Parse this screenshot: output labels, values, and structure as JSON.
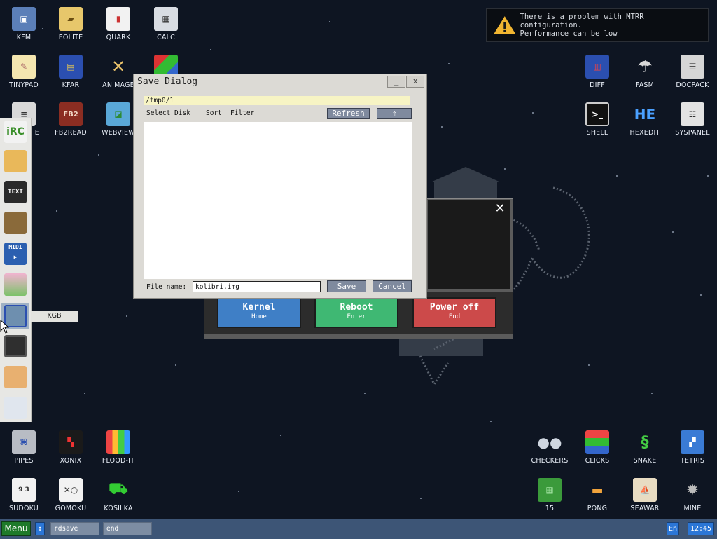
{
  "desktop": {
    "icons_top_left": [
      {
        "label": "KFM",
        "icon": "floppy-icon"
      },
      {
        "label": "EOLITE",
        "icon": "folder-icon"
      },
      {
        "label": "QUARK",
        "icon": "notebook-icon"
      },
      {
        "label": "CALC",
        "icon": "calculator-icon"
      },
      {
        "label": "TINYPAD",
        "icon": "notepad-icon"
      },
      {
        "label": "KFAR",
        "icon": "kfar-icon"
      },
      {
        "label": "ANIMAGE",
        "icon": "paint-tools-icon"
      },
      {
        "label": "E",
        "icon": "text-editor-icon"
      },
      {
        "label": "FB2READ",
        "icon": "book-icon"
      },
      {
        "label": "WEBVIEW",
        "icon": "globe-icon"
      }
    ],
    "icons_top_right": [
      {
        "label": "DIFF",
        "icon": "diff-icon"
      },
      {
        "label": "FASM",
        "icon": "fasm-icon"
      },
      {
        "label": "DOCPACK",
        "icon": "cabinet-icon"
      },
      {
        "label": "SHELL",
        "icon": "terminal-icon"
      },
      {
        "label": "HEXEDIT",
        "icon": "hex-icon"
      },
      {
        "label": "SYSPANEL",
        "icon": "sliders-icon"
      }
    ],
    "icons_bottom_left": [
      {
        "label": "PIPES",
        "icon": "pipes-icon"
      },
      {
        "label": "XONIX",
        "icon": "xonix-icon"
      },
      {
        "label": "FLOOD-IT",
        "icon": "flood-icon"
      },
      {
        "label": "SUDOKU",
        "icon": "sudoku-icon"
      },
      {
        "label": "GOMOKU",
        "icon": "gomoku-icon"
      },
      {
        "label": "KOSILKA",
        "icon": "mower-icon"
      }
    ],
    "icons_bottom_right": [
      {
        "label": "CHECKERS",
        "icon": "checkers-icon"
      },
      {
        "label": "CLICKS",
        "icon": "clicks-icon"
      },
      {
        "label": "SNAKE",
        "icon": "snake-icon"
      },
      {
        "label": "TETRIS",
        "icon": "tetris-icon"
      },
      {
        "label": "15",
        "icon": "fifteen-icon"
      },
      {
        "label": "PONG",
        "icon": "pong-icon"
      },
      {
        "label": "SEAWAR",
        "icon": "seawar-icon"
      },
      {
        "label": "MINE",
        "icon": "mine-icon"
      }
    ]
  },
  "notification": {
    "line1": "There is a problem with MTRR configuration.",
    "line2": "Performance can be low"
  },
  "dock": {
    "tooltip": "KGB",
    "items": [
      "irc-icon",
      "package-icon",
      "text-icon",
      "speaker-icon",
      "midi-icon",
      "image-icon",
      "kgb-icon",
      "cpu-icon",
      "volume-icon",
      "settings-icon"
    ]
  },
  "save_dialog": {
    "title": "Save Dialog",
    "minimize": "_",
    "close": "x",
    "path": "/tmp0/1",
    "menu": [
      "Select Disk",
      "Sort",
      "Filter"
    ],
    "refresh_label": "Refresh",
    "up_label": "⇑",
    "filename_label": "File name:",
    "filename_value": "kolibri.img",
    "save_label": "Save",
    "cancel_label": "Cancel"
  },
  "shutdown_dialog": {
    "close": "✕",
    "buttons": [
      {
        "label": "Kernel",
        "hint": "Home",
        "color": "#3f7fc6"
      },
      {
        "label": "Reboot",
        "hint": "Enter",
        "color": "#3fb873"
      },
      {
        "label": "Power off",
        "hint": "End",
        "color": "#cc4a4a"
      }
    ]
  },
  "taskbar": {
    "menu_label": "Menu",
    "swap_label": "↕",
    "tasks": [
      "rdsave",
      "end"
    ],
    "lang": "En",
    "clock": "12:45"
  }
}
